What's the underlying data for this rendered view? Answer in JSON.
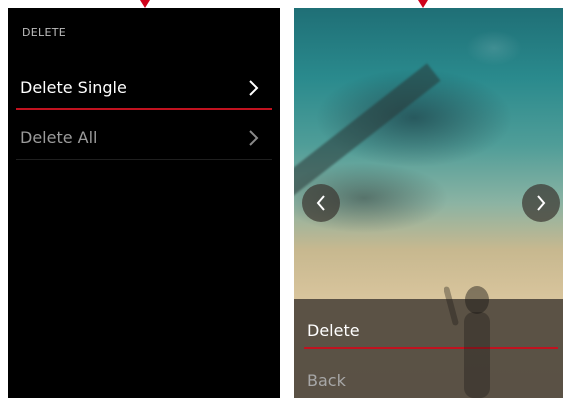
{
  "left_screen": {
    "title": "DELETE",
    "items": [
      {
        "label": "Delete Single",
        "selected": true,
        "icon": "chevron-right-icon"
      },
      {
        "label": "Delete All",
        "selected": false,
        "icon": "chevron-right-icon"
      }
    ]
  },
  "right_screen": {
    "nav": {
      "prev_icon": "chevron-left-icon",
      "next_icon": "chevron-right-icon"
    },
    "panel": {
      "items": [
        {
          "label": "Delete",
          "selected": true
        },
        {
          "label": "Back",
          "selected": false
        }
      ]
    }
  },
  "colors": {
    "accent": "#c1121f",
    "marker": "#d0021b",
    "menu_background": "#000000"
  }
}
